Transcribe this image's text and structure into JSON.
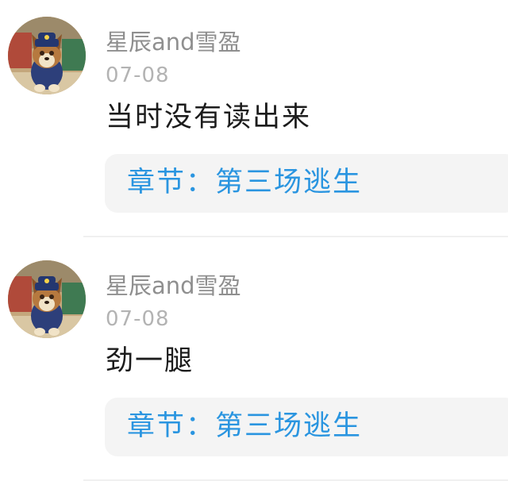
{
  "comments": [
    {
      "username": "星辰and雪盈",
      "date": "07-08",
      "text": "当时没有读出来",
      "chapter_prefix": "章节：",
      "chapter_title": "第三场逃生",
      "avatar_icon": "dog-police-avatar"
    },
    {
      "username": "星辰and雪盈",
      "date": "07-08",
      "text": "劲一腿",
      "chapter_prefix": "章节：",
      "chapter_title": "第三场逃生",
      "avatar_icon": "dog-police-avatar"
    }
  ],
  "colors": {
    "username": "#8f8f8f",
    "timestamp": "#b3b3b3",
    "text": "#1c1c1c",
    "chapter_link": "#2a95e0",
    "chapter_bg": "#f4f4f4"
  }
}
